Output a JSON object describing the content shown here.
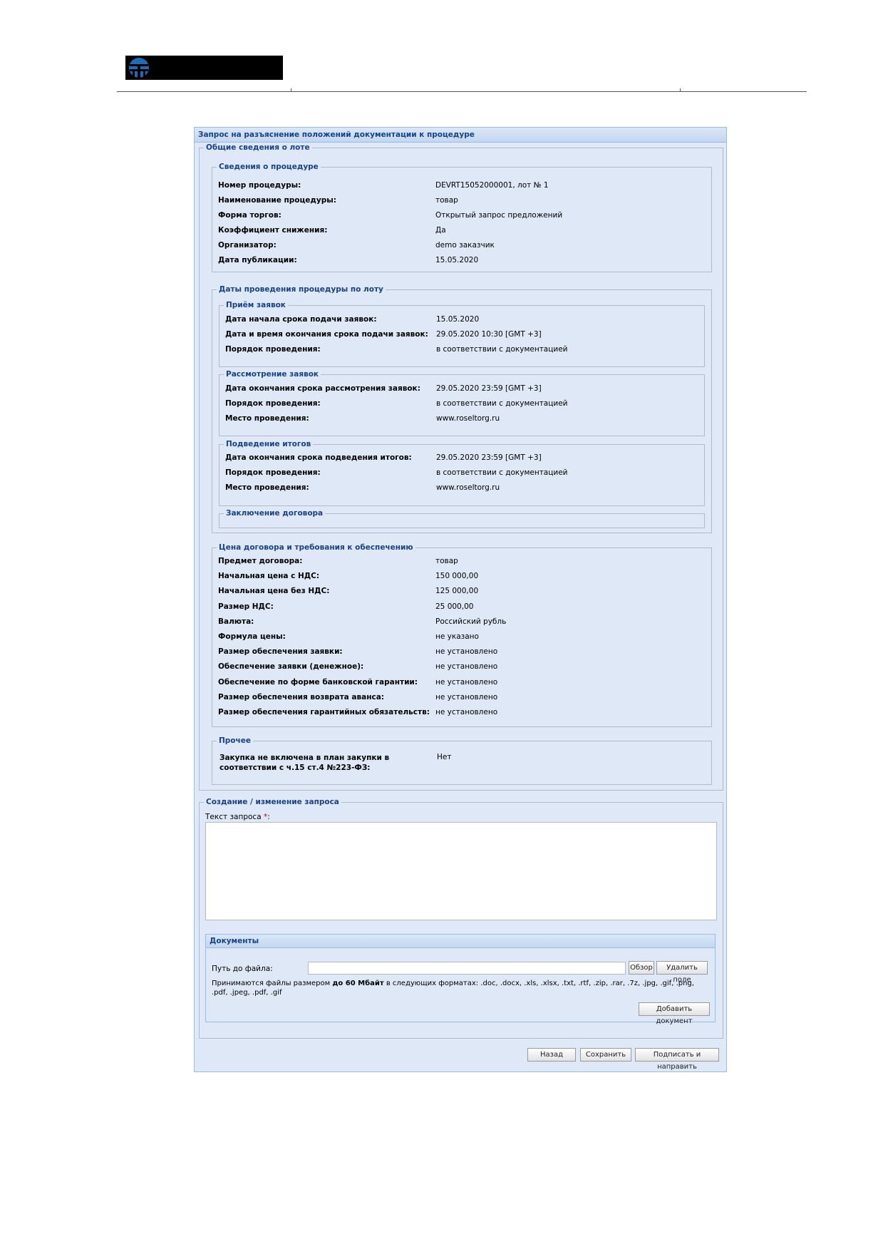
{
  "window": {
    "title": "Запрос на разъяснение положений документации к процедуре"
  },
  "lot": {
    "legend": "Общие сведения о лоте",
    "procedure": {
      "legend": "Сведения о процедуре",
      "rows": [
        {
          "label": "Номер процедуры:",
          "value": "DEVRT15052000001, лот № 1"
        },
        {
          "label": "Наименование процедуры:",
          "value": "товар"
        },
        {
          "label": "Форма торгов:",
          "value": "Открытый запрос предложений"
        },
        {
          "label": "Коэффициент снижения:",
          "value": "Да"
        },
        {
          "label": "Организатор:",
          "value": "demo заказчик"
        },
        {
          "label": "Дата публикации:",
          "value": "15.05.2020"
        }
      ]
    },
    "dates": {
      "legend": "Даты проведения процедуры по лоту",
      "acceptance": {
        "legend": "Приём заявок",
        "rows": [
          {
            "label": "Дата начала срока подачи заявок:",
            "value": "15.05.2020"
          },
          {
            "label": "Дата и время окончания срока подачи заявок:",
            "value": "29.05.2020 10:30 [GMT +3]"
          },
          {
            "label": "Порядок проведения:",
            "value": "в соответствии с документацией"
          }
        ]
      },
      "review": {
        "legend": "Рассмотрение заявок",
        "rows": [
          {
            "label": "Дата окончания срока рассмотрения заявок:",
            "value": "29.05.2020 23:59 [GMT +3]"
          },
          {
            "label": "Порядок проведения:",
            "value": "в соответствии с документацией"
          },
          {
            "label": "Место проведения:",
            "value": "www.roseltorg.ru"
          }
        ]
      },
      "results": {
        "legend": "Подведение итогов",
        "rows": [
          {
            "label": "Дата окончания срока подведения итогов:",
            "value": "29.05.2020 23:59 [GMT +3]"
          },
          {
            "label": "Порядок проведения:",
            "value": "в соответствии с документацией"
          },
          {
            "label": "Место проведения:",
            "value": "www.roseltorg.ru"
          }
        ]
      },
      "contract": {
        "legend": "Заключение договора"
      }
    },
    "price": {
      "legend": "Цена договора и требования к обеспечению",
      "rows": [
        {
          "label": "Предмет договора:",
          "value": "товар"
        },
        {
          "label": "Начальная цена с НДС:",
          "value": "150 000,00"
        },
        {
          "label": "Начальная цена без НДС:",
          "value": "125 000,00"
        },
        {
          "label": "Размер НДС:",
          "value": "25 000,00"
        },
        {
          "label": "Валюта:",
          "value": "Российский рубль"
        },
        {
          "label": "Формула цены:",
          "value": "не указано"
        },
        {
          "label": "Размер обеспечения заявки:",
          "value": "не установлено"
        },
        {
          "label": "Обеспечение заявки (денежное):",
          "value": "не установлено"
        },
        {
          "label": "Обеспечение по форме банковской гарантии:",
          "value": "не установлено"
        },
        {
          "label": "Размер обеспечения возврата аванса:",
          "value": "не установлено"
        },
        {
          "label": "Размер обеспечения гарантийных обязательств:",
          "value": "не установлено"
        }
      ]
    },
    "other": {
      "legend": "Прочее",
      "label_line1": "Закупка не включена в план закупки в",
      "label_line2": "соответствии с ч.15 ст.4 №223-ФЗ:",
      "value": "Нет"
    }
  },
  "request": {
    "legend": "Создание / изменение запроса",
    "text_label": "Текст запроса",
    "required_mark": "*",
    "colon": ":",
    "text_value": ""
  },
  "documents": {
    "title": "Документы",
    "path_label": "Путь до файла:",
    "path_value": "",
    "browse": "Обзор",
    "delete_field": "Удалить поле",
    "info_prefix": "Принимаются файлы размером ",
    "info_size": "до 60 Мбайт",
    "info_line1_rest": " в следующих форматах: .doc, .docx, .xls, .xlsx, .txt, .rtf, .zip, .rar, .7z, .jpg, .gif, .png,",
    "info_line2": ".pdf, .jpeg, .pdf, .gif",
    "add_document": "Добавить документ"
  },
  "footer": {
    "back": "Назад",
    "save": "Сохранить",
    "sign_send": "Подписать и направить"
  },
  "colors": {
    "panel_bg": "#dfe8f6",
    "title_text": "#15428b",
    "border": "#99bbe8",
    "required": "#cc0000"
  }
}
